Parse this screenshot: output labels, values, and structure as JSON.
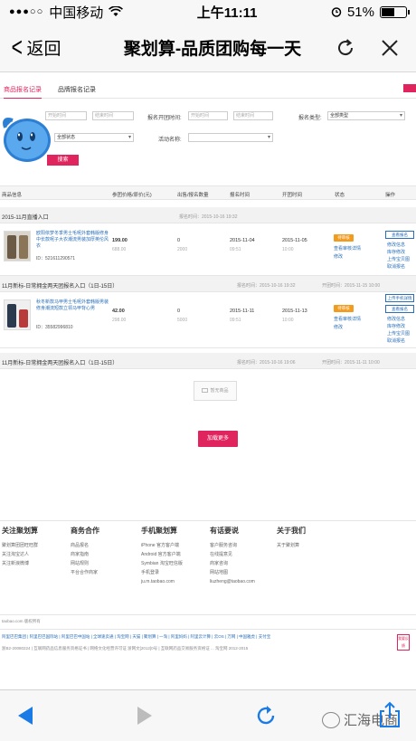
{
  "status_bar": {
    "signal": "●●●○○",
    "carrier": "中国移动",
    "wifi": "wifi-icon",
    "time": "上午11:11",
    "battery_pct": "51%",
    "battery_level": 0.51
  },
  "nav": {
    "back_label": "返回",
    "title": "聚划算-品质团购每一天",
    "refresh_icon": "refresh-icon",
    "close_icon": "close-icon"
  },
  "tabs": [
    "商品报名记录",
    "品牌报名记录"
  ],
  "filters": {
    "start_placeholder": "开始时间",
    "end_placeholder": "结束时间",
    "open_time_label": "报名开团时间:",
    "open_start_placeholder": "开始时间",
    "open_end_placeholder": "结束时间",
    "type_label": "报名类型:",
    "type_value": "全部类型",
    "status_value": "全部状态",
    "activity_label": "活动名称:",
    "search_button": "搜索"
  },
  "table": {
    "headers": [
      "商品信息",
      "参团价格/原价(元)",
      "出售/报名数量",
      "报名时间",
      "开团时间",
      "状态",
      "操作"
    ]
  },
  "groups": [
    {
      "title": "2015-11月直播入口",
      "meta": "报名时间：2015-10-16 19:32",
      "item": {
        "title": "欧阳依梦冬季男士毛呢外套韩版修身中长款呢子大衣潮流男装加厚英伦风衣",
        "id": "ID：521611290571",
        "price": "199.00",
        "orig_price": "688.00",
        "sold": "0",
        "signup_qty": "2000",
        "signup_date": "2015-11-04",
        "signup_time": "09:51",
        "open_date": "2015-11-05",
        "open_time": "10:00",
        "status": "待审核",
        "status_links": [
          "查看审核详情",
          "修改"
        ],
        "ops": [
          "查看报名",
          "修改信息",
          "库存修改",
          "上传宝贝图",
          "取消报名"
        ]
      }
    },
    {
      "title": "11月新标-日常拥金两天团报名入口（1日-15日）",
      "meta_signup": "报名时间：2015-10-16 19:32",
      "meta_open": "开团时间：2015-11-15 10:00",
      "item": {
        "title": "秋冬新款马甲男士毛呢外套韩版男装修身潮流短款立领马甲背心男",
        "id": "ID：35582996810",
        "price": "42.00",
        "orig_price": "298.00",
        "sold": "0",
        "signup_qty": "5000",
        "signup_date": "2015-11-11",
        "signup_time": "09:51",
        "open_date": "2015-11-13",
        "open_time": "10:00",
        "status": "待审核",
        "status_links": [
          "查看审核详情",
          "修改"
        ],
        "ops": [
          "上传手机详情",
          "查看报名",
          "修改信息",
          "库存修改",
          "上传宝贝图",
          "取消报名"
        ]
      }
    },
    {
      "title": "11月新标-日常拥金两天团报名入口（1日-15日）",
      "meta_signup": "报名时间：2015-10-16 19:06",
      "meta_open": "开团时间：2015-11-11 10:00"
    }
  ],
  "empty_text": "暂无商品",
  "load_more": "加载更多",
  "footer": {
    "cols": [
      {
        "title": "关注聚划算",
        "items": [
          "聚划算团团旺旺群",
          "关注淘宝达人",
          "关注新浪微博"
        ]
      },
      {
        "title": "商务合作",
        "items": [
          "商品报名",
          "商家指南",
          "网站规则",
          "平台合作商家"
        ]
      },
      {
        "title": "手机聚划算",
        "items": [
          "iPhone 官方客户端",
          "Android 官方客户端",
          "Symbian 淘宝旺信版",
          "手机登录",
          "ju.m.taobao.com"
        ]
      },
      {
        "title": "有话要说",
        "items": [
          "客户服务咨询",
          "在线提意见",
          "商家咨询",
          "网站地图",
          "liuzheng@taobao.com"
        ]
      },
      {
        "title": "关于我们",
        "items": [
          "关于聚划算"
        ]
      }
    ],
    "copyright_left": "taobao.com 版权所有",
    "links_line": "阿里巴巴集团 | 阿里巴巴国际站 | 阿里巴巴中国站 | 全球速卖通 | 淘宝网 | 天猫 | 聚划算 | 一淘 | 阿里妈妈 | 阿里云计算 | 云OS | 万网 | 中国雅虎 | 支付宝",
    "icp_line": "浙B2-20080224 | 互联网药品信息服务资格证书 | 网络文化经营许可证 浙网文[2012]0号 | 互联网药品交易服务资格证 ... 淘宝网 2012-2015",
    "side_tab": "我要反馈"
  },
  "toolbar": {
    "back_icon": "back-arrow-icon",
    "forward_icon": "forward-arrow-icon",
    "refresh_icon": "refresh-icon",
    "share_icon": "share-icon",
    "watermark": "汇海电商"
  },
  "colors": {
    "accent": "#e0245e",
    "link": "#2a6fb8",
    "status_tag": "#f29c1f",
    "ios_blue": "#1a7be6"
  }
}
